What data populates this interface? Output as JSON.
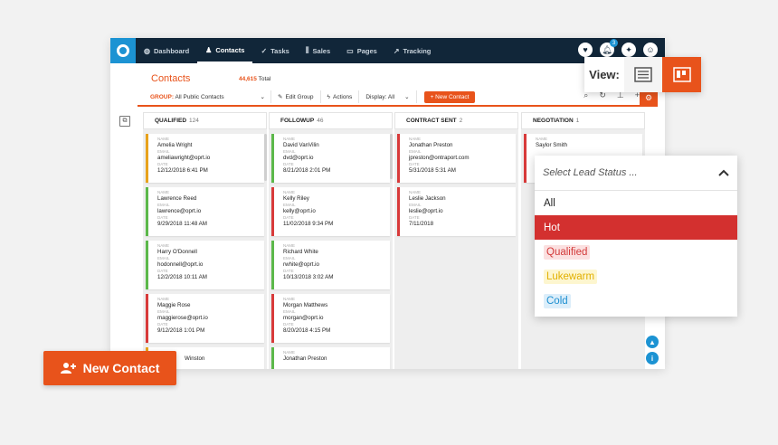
{
  "nav": {
    "items": [
      {
        "label": "Dashboard",
        "icon": "dashboard-icon",
        "glyph": "◍"
      },
      {
        "label": "Contacts",
        "icon": "person-icon",
        "glyph": "♟"
      },
      {
        "label": "Tasks",
        "icon": "check-icon",
        "glyph": "✓"
      },
      {
        "label": "Sales",
        "icon": "bars-icon",
        "glyph": "⫼"
      },
      {
        "label": "Pages",
        "icon": "page-icon",
        "glyph": "▭"
      },
      {
        "label": "Tracking",
        "icon": "trend-icon",
        "glyph": "↗"
      }
    ],
    "notifications_count": "3"
  },
  "page": {
    "title": "Contacts",
    "total_count": "44,615",
    "total_label": "Total"
  },
  "toolbar": {
    "group_label": "GROUP:",
    "group_value": "All Public Contacts",
    "edit_group": "Edit Group",
    "actions": "Actions",
    "display": "Display: All",
    "new_contact": "New Contact"
  },
  "columns": [
    {
      "title": "QUALIFIED",
      "count": "124"
    },
    {
      "title": "FOLLOWUP",
      "count": "46"
    },
    {
      "title": "CONTRACT SENT",
      "count": "2"
    },
    {
      "title": "NEGOTIATION",
      "count": "1"
    }
  ],
  "field_labels": {
    "name": "NAME",
    "email": "EMAIL",
    "date": "DATE"
  },
  "cards": {
    "qualified": [
      {
        "name": "Amelia Wright",
        "email": "ameliawright@oprt.io",
        "date": "12/12/2018 6:41 PM",
        "status": "orange"
      },
      {
        "name": "Lawrence Reed",
        "email": "lawrence@oprt.io",
        "date": "9/29/2018 11:48 AM",
        "status": "green"
      },
      {
        "name": "Harry O'Donnell",
        "email": "hodonnell@oprt.io",
        "date": "12/2/2018 10:11 AM",
        "status": "green"
      },
      {
        "name": "Maggie Rose",
        "email": "maggierose@oprt.io",
        "date": "9/12/2018 1:01 PM",
        "status": "red"
      },
      {
        "name": "Winston",
        "email": "",
        "date": "",
        "status": "orange"
      }
    ],
    "followup": [
      {
        "name": "David VanVilin",
        "email": "dvd@oprt.io",
        "date": "8/21/2018 2:01 PM",
        "status": "green"
      },
      {
        "name": "Kelly Riley",
        "email": "kelly@oprt.io",
        "date": "11/02/2018 9:34 PM",
        "status": "red"
      },
      {
        "name": "Richard White",
        "email": "rwhite@oprt.io",
        "date": "10/13/2018 3:02 AM",
        "status": "green"
      },
      {
        "name": "Morgan Matthews",
        "email": "morgan@oprt.io",
        "date": "8/20/2018 4:15 PM",
        "status": "red"
      },
      {
        "name": "Jonathan Preston",
        "email": "",
        "date": "",
        "status": "green"
      }
    ],
    "contract_sent": [
      {
        "name": "Jonathan Preston",
        "email": "jpreston@ontraport.com",
        "date": "5/31/2018 5:31 AM",
        "status": "red"
      },
      {
        "name": "Leslie Jackson",
        "email": "leslie@oprt.io",
        "date": "7/11/2018",
        "status": "red"
      }
    ],
    "negotiation": [
      {
        "name": "Saylor Smith",
        "email": "",
        "date": "",
        "status": "red"
      }
    ]
  },
  "view_switch": {
    "label": "View:"
  },
  "lead_status": {
    "placeholder": "Select Lead Status ...",
    "options": [
      "All",
      "Hot",
      "Qualified",
      "Lukewarm",
      "Cold"
    ],
    "selected": "Hot"
  },
  "cta": {
    "label": "New Contact"
  },
  "colors": {
    "accent": "#e8531b",
    "nav_bg": "#112639",
    "brand_blue": "#1c93d3",
    "hot": "#d3302f"
  }
}
